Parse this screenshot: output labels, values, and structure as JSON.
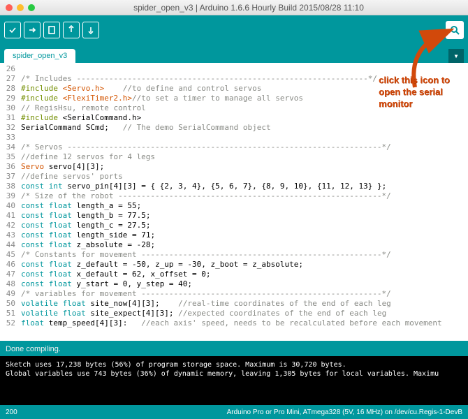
{
  "window": {
    "title": "spider_open_v3 | Arduino 1.6.6 Hourly Build 2015/08/28 11:10"
  },
  "tab": {
    "name": "spider_open_v3"
  },
  "status": {
    "text": "Done compiling."
  },
  "footer": {
    "left": "200",
    "right": "Arduino Pro or Pro Mini, ATmega328 (5V, 16 MHz) on /dev/cu.Regis-1-DevB"
  },
  "console": {
    "l1": "",
    "l2": "Sketch uses 17,238 bytes (56%) of program storage space. Maximum is 30,720 bytes.",
    "l3": "Global variables use 743 bytes (36%) of dynamic memory, leaving 1,305 bytes for local variables. Maximu"
  },
  "annotation": {
    "l1": "click this icon to",
    "l2": "open the serial",
    "l3": "monitor"
  },
  "code": {
    "l26": "",
    "l27": {
      "c": "/* Includes ---------------------------------------------------------------*/"
    },
    "l28": {
      "inc": "#include ",
      "lib": "<Servo.h>",
      "sp": "    ",
      "c": "//to define and control servos"
    },
    "l29": {
      "inc": "#include ",
      "lib": "<FlexiTimer2.h>",
      "c": "//to set a timer to manage all servos"
    },
    "l30": {
      "c": "// RegisHsu, remote control"
    },
    "l31": {
      "inc": "#include ",
      "t": "<SerialCommand.h>"
    },
    "l32": {
      "t": "SerialCommand SCmd;   ",
      "c": "// The demo SerialCommand object"
    },
    "l33": "",
    "l34": {
      "c": "/* Servos --------------------------------------------------------------------*/"
    },
    "l35": {
      "c": "//define 12 servos for 4 legs"
    },
    "l36": {
      "t": "Servo",
      " servo": "[4][3];",
      "txt": " servo[4][3];"
    },
    "l37": {
      "c": "//define servos' ports"
    },
    "l38": {
      "kw": "const int",
      "t": " servo_pin[4][3] = { {2, 3, 4}, {5, 6, 7}, {8, 9, 10}, {11, 12, 13} };"
    },
    "l39": {
      "c": "/* Size of the robot ---------------------------------------------------------*/"
    },
    "l40": {
      "kw": "const float",
      "t": " length_a = 55;"
    },
    "l41": {
      "kw": "const float",
      "t": " length_b = 77.5;"
    },
    "l42": {
      "kw": "const float",
      "t": " length_c = 27.5;"
    },
    "l43": {
      "kw": "const float",
      "t": " length_side = 71;"
    },
    "l44": {
      "kw": "const float",
      "t": " z_absolute = -28;"
    },
    "l45": {
      "c": "/* Constants for movement ----------------------------------------------------*/"
    },
    "l46": {
      "kw": "const float",
      "t": " z_default = -50, z_up = -30, z_boot = z_absolute;"
    },
    "l47": {
      "kw": "const float",
      "t": " x_default = 62, x_offset = 0;"
    },
    "l48": {
      "kw": "const float",
      "t": " y_start = 0, y_step = 40;"
    },
    "l49": {
      "c": "/* variables for movement ----------------------------------------------------*/"
    },
    "l50": {
      "kw": "volatile float",
      "t": " site_now[4][3];    ",
      "c": "//real-time coordinates of the end of each leg"
    },
    "l51": {
      "kw": "volatile float",
      "t": " site_expect[4][3]; ",
      "c": "//expected coordinates of the end of each leg"
    },
    "l52": {
      "kw": "float",
      "t": " temp_speed[4][3]:   ",
      "c": "//each axis' speed, needs to be recalculated before each movement"
    }
  }
}
